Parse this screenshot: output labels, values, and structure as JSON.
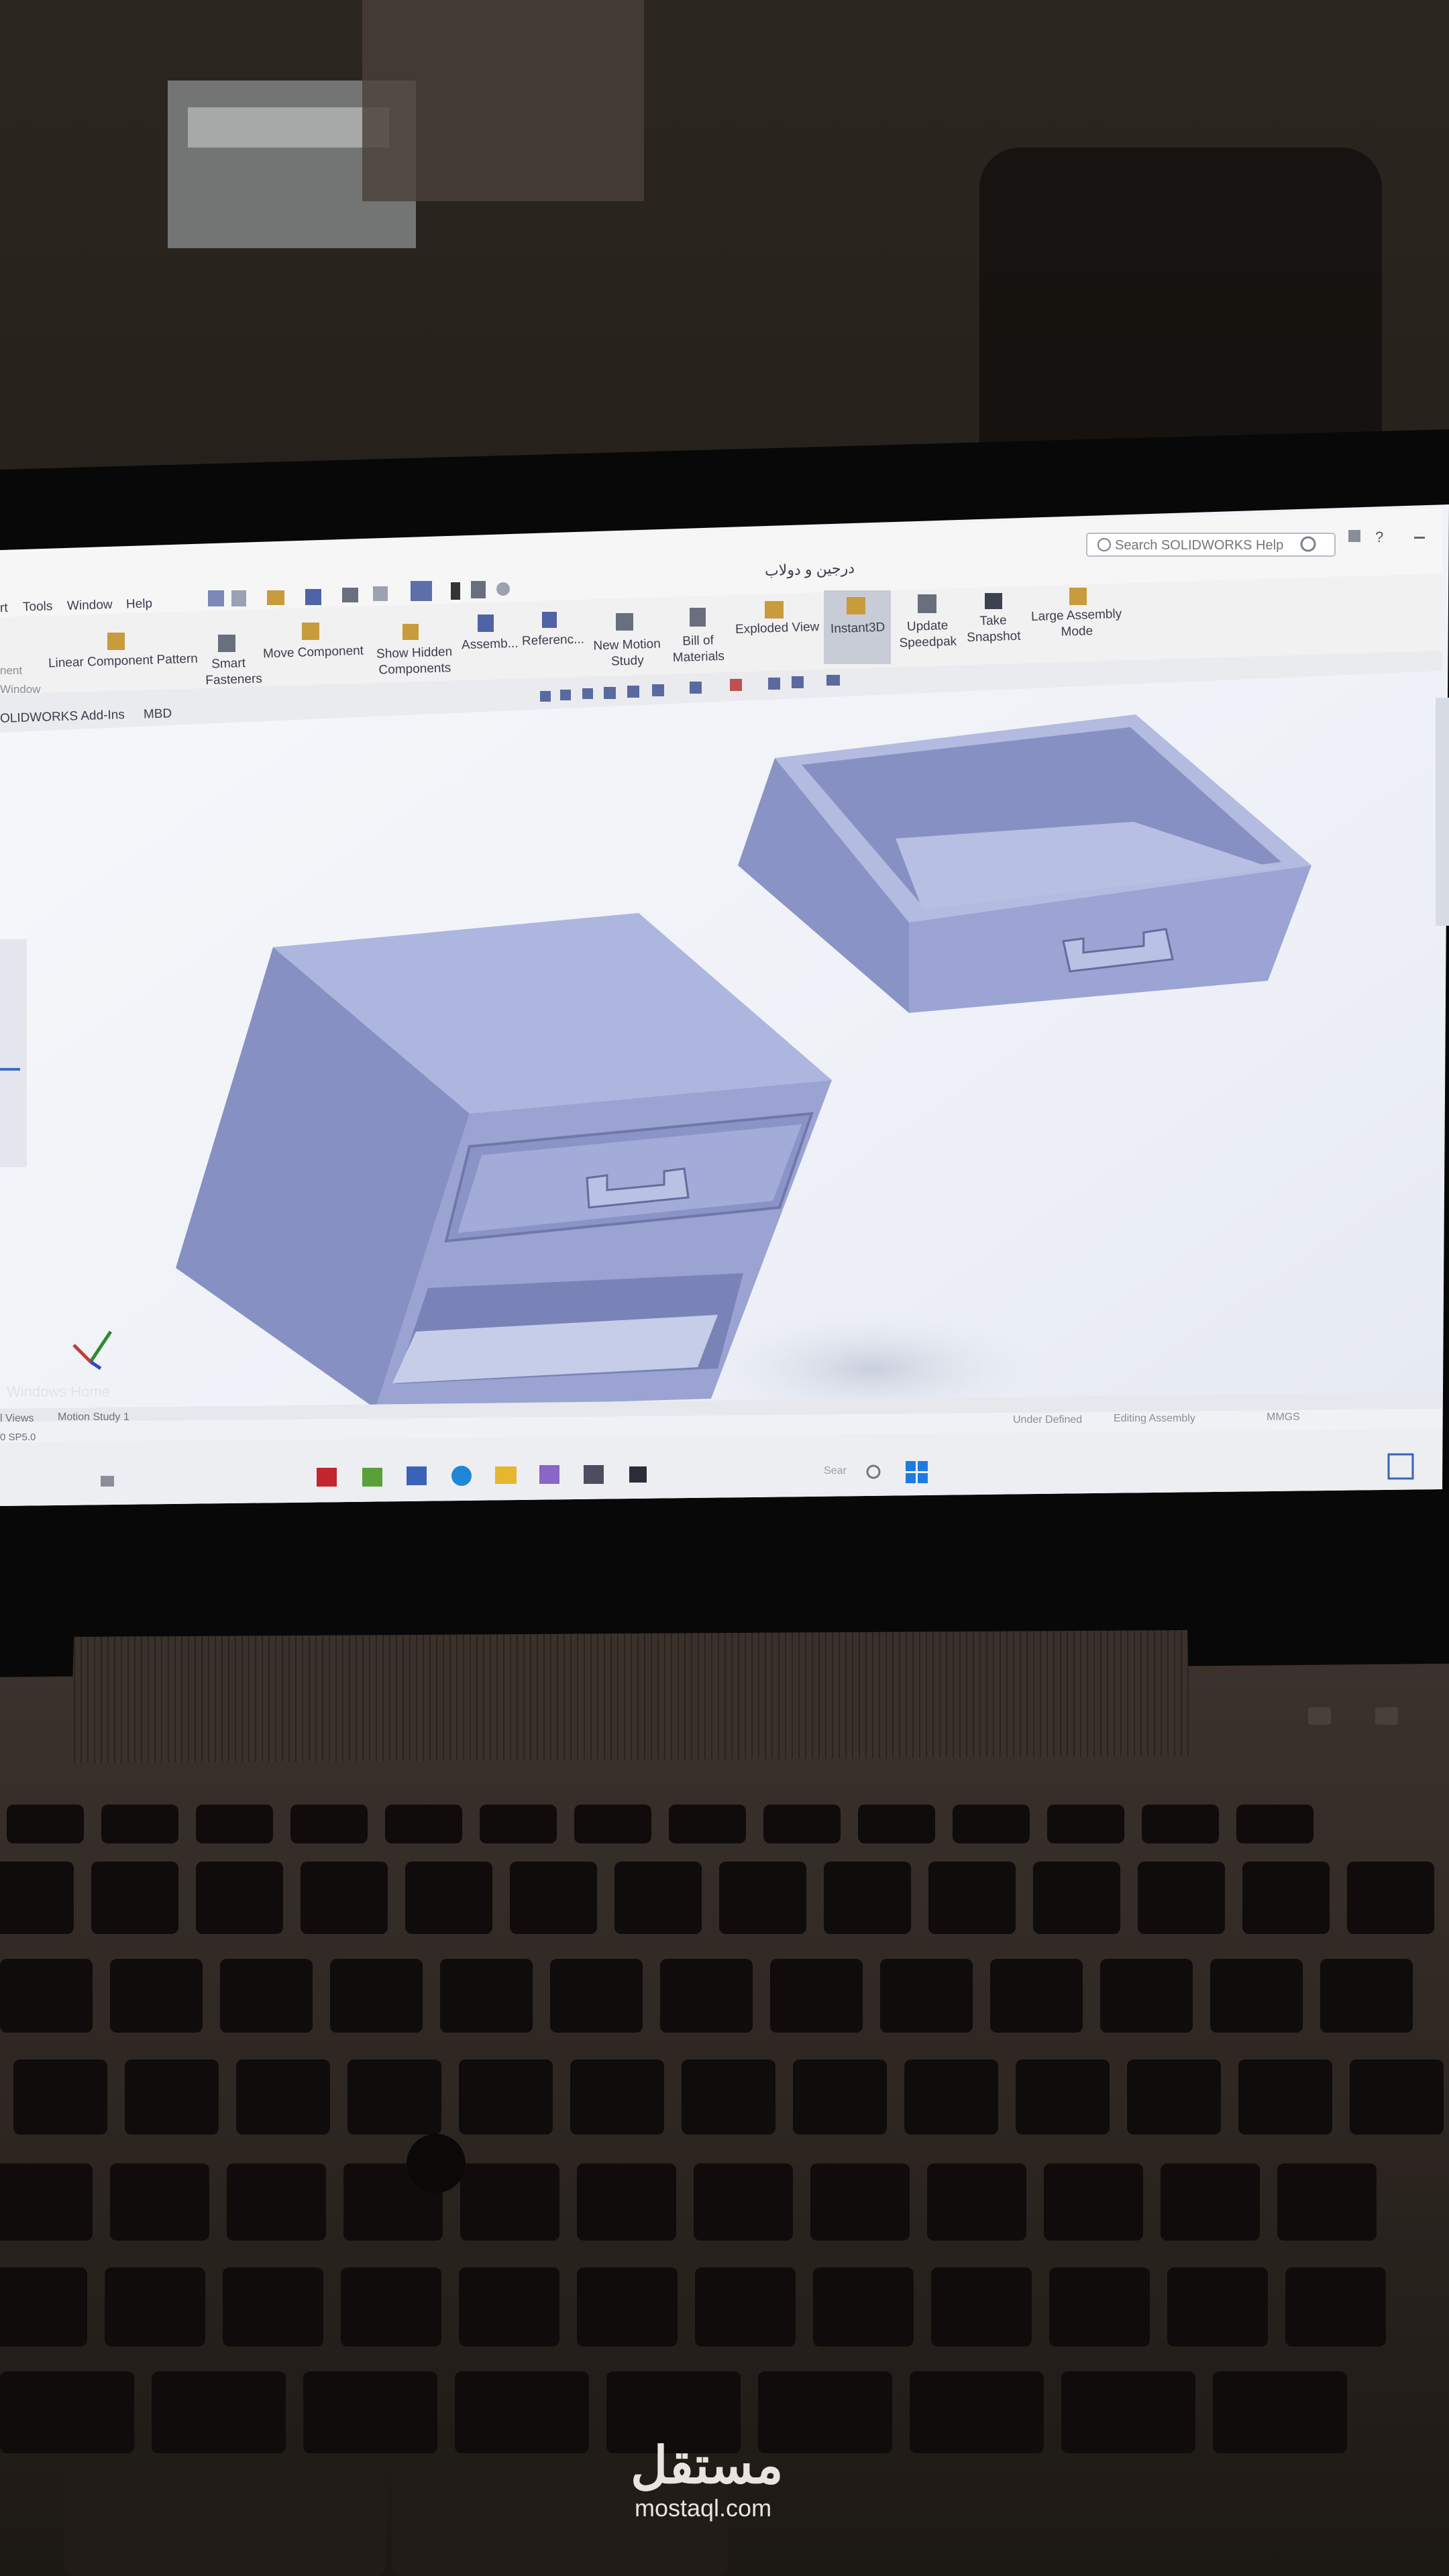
{
  "app": {
    "title": "درجين و دولاب",
    "search_placeholder": "Search SOLIDWORKS Help"
  },
  "menu": [
    "rt",
    "Tools",
    "Window",
    "Help"
  ],
  "ribbon": [
    {
      "label": "Linear Component Pattern",
      "icon": "pattern-icon"
    },
    {
      "label": "Smart Fasteners",
      "icon": "fastener-icon"
    },
    {
      "label": "Move Component",
      "icon": "move-icon"
    },
    {
      "label": "Show Hidden Components",
      "icon": "show-hidden-icon"
    },
    {
      "label": "Assemb...",
      "icon": "assembly-icon"
    },
    {
      "label": "Referenc...",
      "icon": "reference-icon"
    },
    {
      "label": "New Motion Study",
      "icon": "motion-icon"
    },
    {
      "label": "Bill of Materials",
      "icon": "bom-icon"
    },
    {
      "label": "Exploded View",
      "icon": "explode-icon"
    },
    {
      "label": "Instant3D",
      "icon": "instant3d-icon",
      "active": true
    },
    {
      "label": "Update Speedpak",
      "icon": "speedpak-icon"
    },
    {
      "label": "Take Snapshot",
      "icon": "camera-icon"
    },
    {
      "label": "Large Assembly Mode",
      "icon": "large-assembly-icon"
    }
  ],
  "left_fragment": {
    "line1": "nent",
    "line2": "Window"
  },
  "tabs": [
    "OLIDWORKS Add-Ins",
    "MBD"
  ],
  "bottom_tabs": [
    "l Views",
    "Motion Study 1"
  ],
  "status": {
    "version": "0 SP5.0",
    "left": "Under Defined",
    "middle": "Editing Assembly",
    "units": "MMGS"
  },
  "watermark": "Windows Home",
  "taskbar": {
    "search_label": "Sear"
  },
  "logo": {
    "arabic": "مستقل",
    "latin": "mostaql.com"
  },
  "colors": {
    "part_face": "#a9b3dc",
    "part_side": "#7f89bd",
    "viewport": "#f4f6fa",
    "ribbon": "#f1f1f2",
    "taskbar": "#edeef2"
  }
}
